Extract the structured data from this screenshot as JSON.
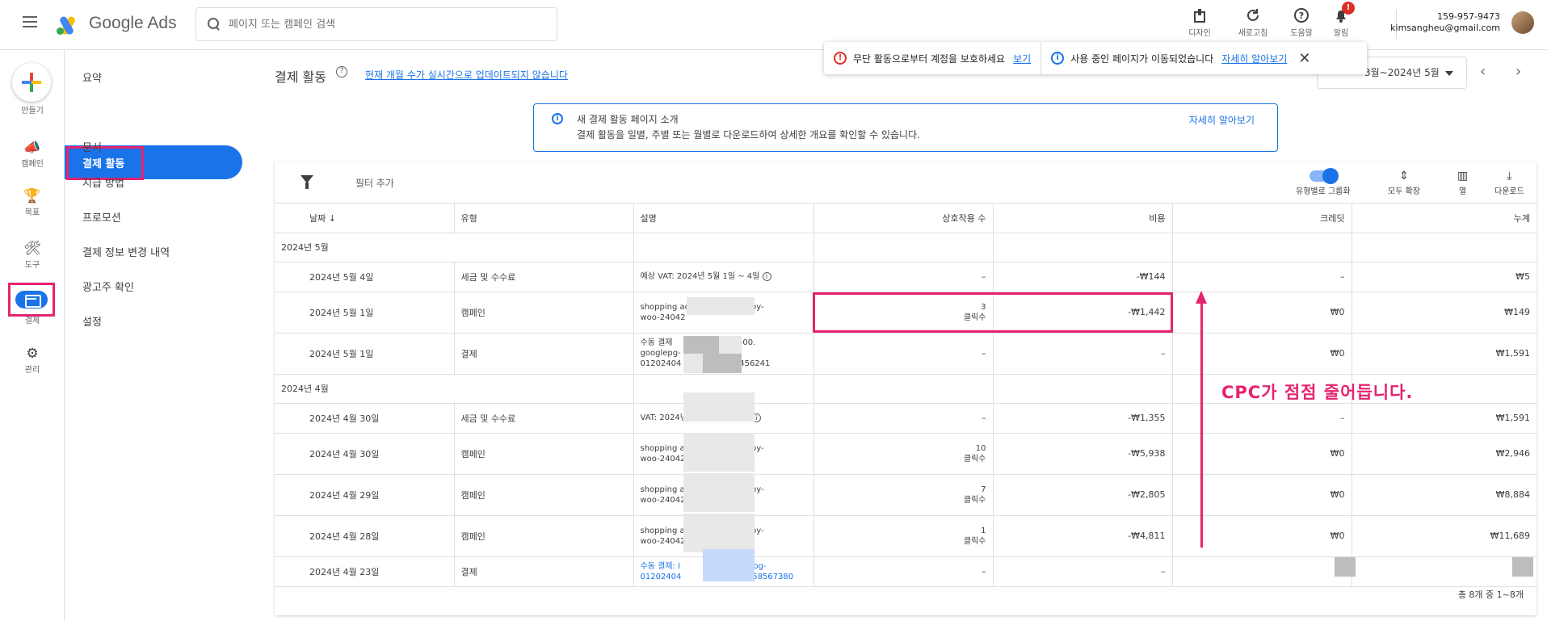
{
  "app": {
    "name": "Google Ads"
  },
  "search": {
    "placeholder": "페이지 또는 캠페인 검색"
  },
  "top_actions": [
    {
      "label": "디자인",
      "icon": "design-icon"
    },
    {
      "label": "새로고침",
      "icon": "refresh-icon"
    },
    {
      "label": "도움말",
      "icon": "help-icon"
    },
    {
      "label": "알림",
      "icon": "notification-bell-icon",
      "badge": "!"
    }
  ],
  "account": {
    "id": "159-957-9473",
    "email": "kimsangheu@gmail.com"
  },
  "rail": {
    "create": "만들기",
    "items": [
      "캠페인",
      "목표",
      "도구",
      "결제",
      "관리"
    ]
  },
  "subnav": {
    "items": [
      "요약",
      "결제 활동",
      "문서",
      "지급 방법",
      "프로모션",
      "결제 정보 변경 내역",
      "광고주 확인",
      "설정"
    ],
    "active": "결제 활동"
  },
  "header": {
    "title": "결제 활동",
    "update_link": "현재 개월 수가 실시간으로 업데이트되지 않습니다",
    "date_range": "3월~2024년 5월"
  },
  "alert": {
    "security_text": "무단 활동으로부터 계정을 보호하세요",
    "security_link": "보기",
    "move_text": "사용 중인 페이지가 이동되었습니다",
    "move_link": "자세히 알아보기"
  },
  "banner": {
    "title": "새 결제 활동 페이지 소개",
    "body": "결제 활동을 일별, 주별 또는 월별로 다운로드하여 상세한 개요를 확인할 수 있습니다.",
    "link": "자세히 알아보기"
  },
  "toolbar": {
    "filter_add": "필터 추가",
    "group_by_type": "유형별로 그룹화",
    "expand_all": "모두 확장",
    "columns": "열",
    "download": "다운로드"
  },
  "table": {
    "headers": [
      "날짜 ↓",
      "유형",
      "설명",
      "상호작용 수",
      "비용",
      "크레딧",
      "누계"
    ],
    "groups": [
      {
        "label": "2024년 5월",
        "rows": [
          {
            "date": "2024년 5월 4일",
            "type": "세금 및 수수료",
            "desc": [
              "예상 VAT: 2024년 5월 1일 ~ 4일"
            ],
            "interactions": "–",
            "interactions_unit": "",
            "cost": "-₩144",
            "credit": "–",
            "total": "₩5"
          },
          {
            "date": "2024년 5월 1일",
            "type": "캠페인",
            "desc": [
              "shopping ac",
              "gs-Ads-by-",
              "woo-24042"
            ],
            "interactions": "3",
            "interactions_unit": "클릭수",
            "cost": "-₩1,442",
            "credit": "₩0",
            "total": "₩149"
          },
          {
            "date": "2024년 5월 1일",
            "type": "결제",
            "desc": [
              "수동 결제 ",
              "비스 ₩16,500.",
              "googlepg-",
              "01202404",
              "38300456241"
            ],
            "interactions": "–",
            "interactions_unit": "",
            "cost": "–",
            "credit": "₩0",
            "total": "₩1,591"
          }
        ]
      },
      {
        "label": "2024년 4월",
        "rows": [
          {
            "date": "2024년 4월 30일",
            "type": "세금 및 수수료",
            "desc": [
              "VAT: 2024년"
            ],
            "interactions": "–",
            "interactions_unit": "",
            "cost": "-₩1,355",
            "credit": "–",
            "total": "₩1,591"
          },
          {
            "date": "2024년 4월 30일",
            "type": "캠페인",
            "desc": [
              "shopping ac",
              "gs-Ads-by-",
              "woo-24042"
            ],
            "interactions": "10",
            "interactions_unit": "클릭수",
            "cost": "-₩5,938",
            "credit": "₩0",
            "total": "₩2,946"
          },
          {
            "date": "2024년 4월 29일",
            "type": "캠페인",
            "desc": [
              "shopping ac",
              "gs-Ads-by-",
              "woo-24042"
            ],
            "interactions": "7",
            "interactions_unit": "클릭수",
            "cost": "-₩2,805",
            "credit": "₩0",
            "total": "₩8,884"
          },
          {
            "date": "2024년 4월 28일",
            "type": "캠페인",
            "desc": [
              "shopping ac",
              "gs-Ads-by-",
              "woo-24042"
            ],
            "interactions": "1",
            "interactions_unit": "클릭수",
            "cost": "-₩4,811",
            "credit": "₩0",
            "total": "₩11,689"
          },
          {
            "date": "2024년 4월 23일",
            "type": "결제",
            "desc": [
              "수동 결제: I",
              ". googlepg-",
              "01202404",
              "0524158567380"
            ],
            "interactions": "–",
            "interactions_unit": "",
            "cost": "–",
            "credit": "",
            "total": ""
          }
        ]
      }
    ],
    "footer": "총 8개 중 1~8개"
  },
  "annotation": {
    "text": "CPC가 점점 줄어듭니다."
  },
  "colors": {
    "accent": "#1a73e8",
    "annotation": "#e5236f",
    "error": "#d93025"
  }
}
